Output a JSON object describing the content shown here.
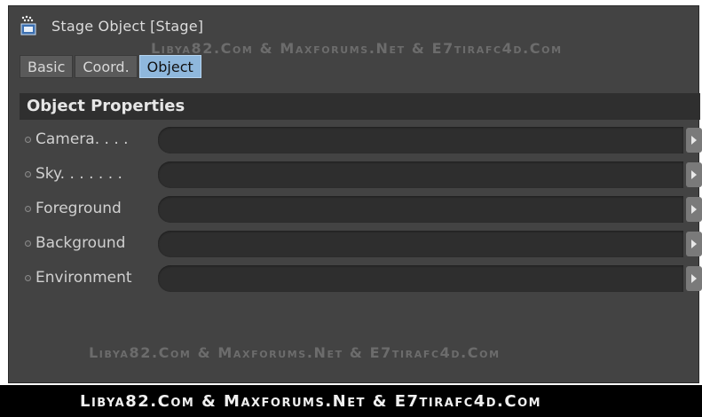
{
  "window": {
    "title": "Stage Object [Stage]"
  },
  "tabs": [
    {
      "label": "Basic",
      "active": false
    },
    {
      "label": "Coord.",
      "active": false
    },
    {
      "label": "Object",
      "active": true
    }
  ],
  "section": {
    "title": "Object Properties"
  },
  "properties": [
    {
      "label": "Camera. . . ."
    },
    {
      "label": "Sky. . . . . . ."
    },
    {
      "label": "Foreground"
    },
    {
      "label": "Background"
    },
    {
      "label": "Environment"
    }
  ],
  "watermarks": {
    "top": "Libya82.Com & Maxforums.Net & E7tirafc4d.Com",
    "middle": "Libya82.Com & Maxforums.Net & E7tirafc4d.Com",
    "footer": "Libya82.Com & Maxforums.Net & E7tirafc4d.Com"
  },
  "colors": {
    "panel_bg": "#434343",
    "active_tab": "#8fb8dd",
    "field_bg": "#2e2e2e",
    "footer_bg": "#000000"
  },
  "icons": {
    "title": "clapperboard-icon",
    "row_bullet": "circle-icon",
    "field_arrow": "triangle-right-icon"
  }
}
